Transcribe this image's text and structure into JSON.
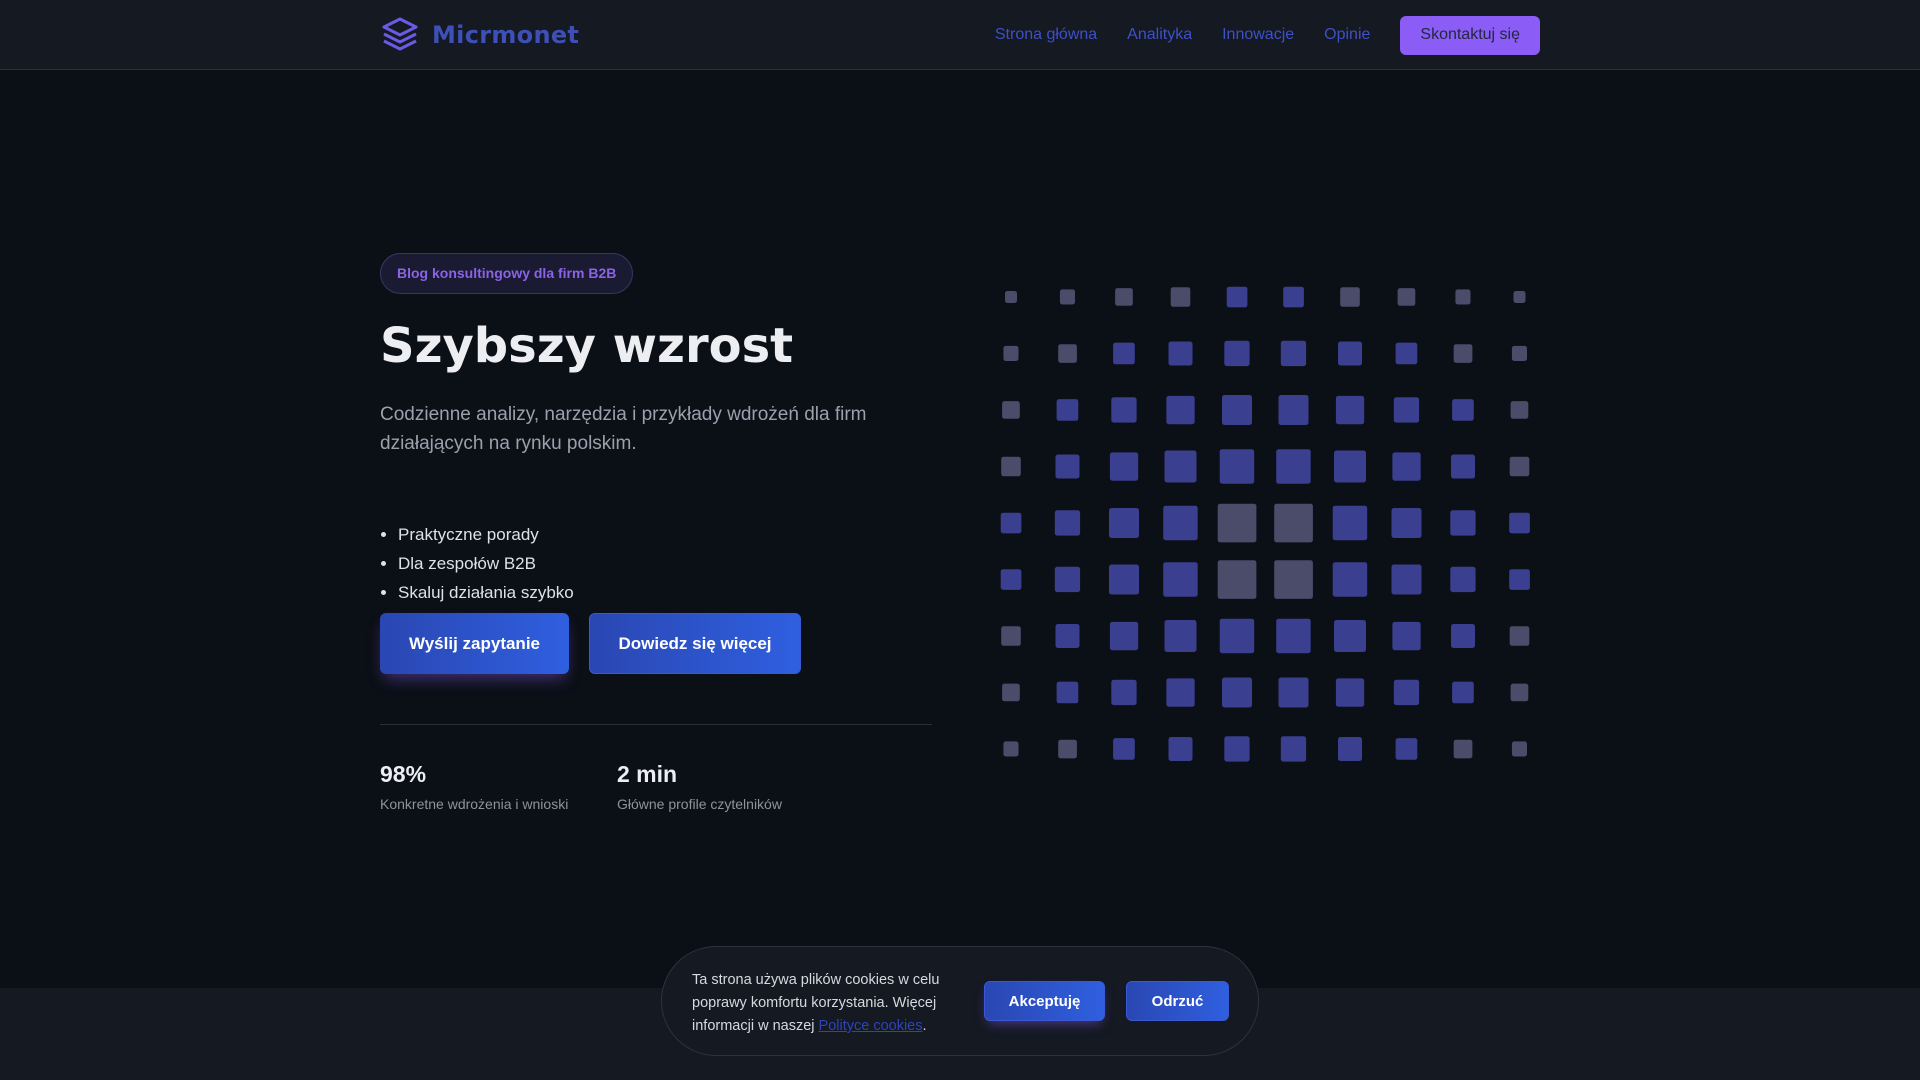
{
  "header": {
    "brand": "Micrmonet",
    "logo_icon": "stack-layers-icon",
    "nav": [
      {
        "label": "Strona główna"
      },
      {
        "label": "Analityka"
      },
      {
        "label": "Innowacje"
      },
      {
        "label": "Opinie"
      }
    ],
    "cta_label": "Skontaktuj się"
  },
  "hero": {
    "badge": "Blog konsultingowy dla firm B2B",
    "title": "Szybszy wzrost",
    "subtitle": "Codzienne analizy, narzędzia i przykłady wdrożeń dla firm działających na rynku polskim.",
    "features": [
      "Praktyczne porady",
      "Dla zespołów B2B",
      "Skaluj działania szybko"
    ],
    "primary_button": "Wyślij zapytanie",
    "secondary_button": "Dowiedz się więcej",
    "stats": [
      {
        "value": "98%",
        "label": "Konkretne wdrożenia i wnioski"
      },
      {
        "value": "2 min",
        "label": "Główne profile czytelników"
      }
    ]
  },
  "cookie": {
    "text": "Ta strona używa plików cookies w celu poprawy komfortu korzystania. Więcej informacji w naszej",
    "link": "Polityce cookies",
    "suffix": ".",
    "accept": "Akceptuję",
    "reject": "Odrzuć"
  },
  "colors": {
    "background": "#0b0f16",
    "header": "#141922",
    "brand_blue": "#3f4fb8",
    "accent_purple": "#8b5cf6",
    "button_blue": "#2f5fe0",
    "grid_square": "#3b3f8f",
    "grid_square_muted": "#4a4c6a"
  }
}
